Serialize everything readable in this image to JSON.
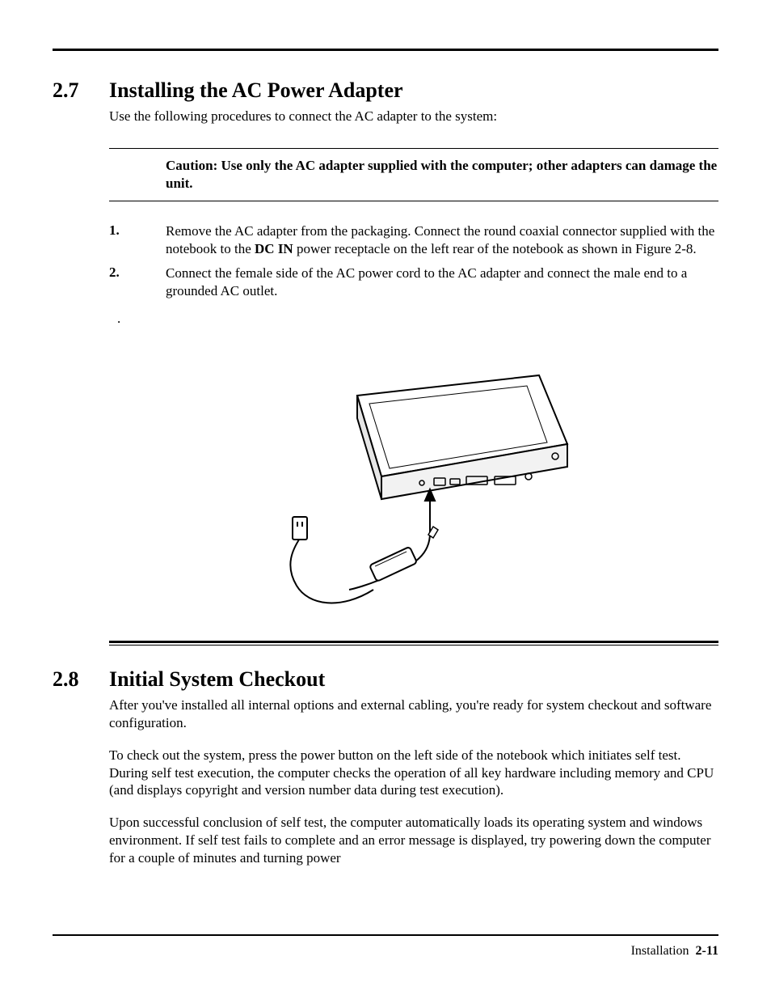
{
  "section27": {
    "num": "2.7",
    "title": "Installing the AC Power Adapter",
    "intro": "Use the following procedures to connect the AC adapter to the system:",
    "caution": "Caution: Use only the AC adapter supplied with the computer; other adapters can damage the unit.",
    "steps": [
      {
        "num": "1.",
        "text_before": "Remove the AC adapter from the packaging. Connect the round coaxial connector supplied with the notebook to the ",
        "bold": "DC IN",
        "text_after": " power receptacle on the left rear of the notebook as shown in Figure 2-8."
      },
      {
        "num": "2.",
        "text_before": "Connect the female side of the AC power cord to the AC adapter and connect the male end to a grounded AC outlet.",
        "bold": "",
        "text_after": ""
      }
    ],
    "stray": "."
  },
  "section28": {
    "num": "2.8",
    "title": "Initial System Checkout",
    "paras": [
      "After you've installed all internal options and external cabling, you're ready for system checkout and software configuration.",
      "To check out the system, press the power button on the left side of the notebook which initiates self test. During self test execution, the computer checks the operation of all key hardware including memory and CPU (and displays copyright and version number data during test execution).",
      "Upon successful conclusion of self test, the computer automatically loads its operating system and windows environment. If self test fails to complete and an error message is displayed, try powering down the computer for a couple of minutes and turning power"
    ]
  },
  "footer": {
    "label": "Installation",
    "page": "2-11"
  },
  "figure": {
    "alt": "Line drawing of a notebook computer with an AC adapter cable connecting to the DC IN port on the rear, and the adapter plugging into a wall outlet."
  }
}
